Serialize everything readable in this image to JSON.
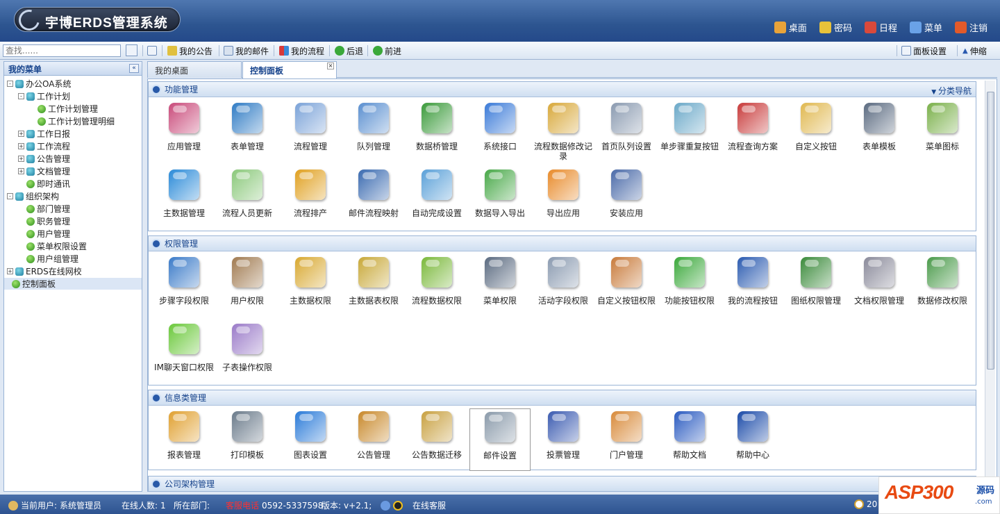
{
  "app": {
    "title": "宇博ERDS管理系统"
  },
  "topnav": [
    {
      "label": "桌面",
      "icon": "home-icon",
      "color": "#e8a33a"
    },
    {
      "label": "密码",
      "icon": "lock-icon",
      "color": "#e8c23a"
    },
    {
      "label": "日程",
      "icon": "calendar-icon",
      "color": "#d9493b"
    },
    {
      "label": "菜单",
      "icon": "menu-icon",
      "color": "#6aa2e8"
    },
    {
      "label": "注销",
      "icon": "power-icon",
      "color": "#e25a2a"
    }
  ],
  "toolbar": {
    "search_placeholder": "查找......",
    "items": [
      "我的公告",
      "我的邮件",
      "我的流程",
      "后退",
      "前进"
    ],
    "right": [
      "面板设置",
      "伸缩"
    ]
  },
  "sidebar": {
    "title": "我的菜单",
    "tree": [
      "办公OA系统",
      "工作计划",
      "工作计划管理",
      "工作计划管理明细",
      "工作日报",
      "工作流程",
      "公告管理",
      "文档管理",
      "即时通讯",
      "组织架构",
      "部门管理",
      "职务管理",
      "用户管理",
      "菜单权限设置",
      "用户组管理",
      "ERDS在线网校",
      "控制面板"
    ]
  },
  "tabs": [
    "我的桌面",
    "控制面板"
  ],
  "sections": [
    {
      "title": "功能管理",
      "nav": "分类导航",
      "items": [
        [
          "应用管理",
          "#c94a7a"
        ],
        [
          "表单管理",
          "#2f7bc4"
        ],
        [
          "流程管理",
          "#7aa2d8"
        ],
        [
          "队列管理",
          "#5a8fd0"
        ],
        [
          "数据桥管理",
          "#3a9a3a"
        ],
        [
          "系统接口",
          "#3a7ad8"
        ],
        [
          "流程数据修改记录",
          "#d8a83a"
        ],
        [
          "首页队列设置",
          "#8a9ab0"
        ],
        [
          "单步骤重复按钮",
          "#6aa8c8"
        ],
        [
          "流程查询方案",
          "#c83a3a"
        ],
        [
          "自定义按钮",
          "#e0b850"
        ],
        [
          "表单模板",
          "#5a6a80"
        ],
        [
          "菜单图标",
          "#7ab04a"
        ],
        [
          "主数据管理",
          "#2a8ad8"
        ],
        [
          "流程人员更新",
          "#8ac87a"
        ],
        [
          "流程排产",
          "#e0a020"
        ],
        [
          "邮件流程映射",
          "#3a6ab0"
        ],
        [
          "自动完成设置",
          "#5aa0d8"
        ],
        [
          "数据导入导出",
          "#48a848"
        ],
        [
          "导出应用",
          "#e88a2a"
        ],
        [
          "安装应用",
          "#4a6aa8"
        ]
      ]
    },
    {
      "title": "权限管理",
      "items": [
        [
          "步骤字段权限",
          "#3a7ac8"
        ],
        [
          "用户权限",
          "#a07a50"
        ],
        [
          "主数据权限",
          "#d8a830"
        ],
        [
          "主数据表权限",
          "#c8a838"
        ],
        [
          "流程数据权限",
          "#7ab83a"
        ],
        [
          "菜单权限",
          "#5a6a80"
        ],
        [
          "活动字段权限",
          "#8a9ab0"
        ],
        [
          "自定义按钮权限",
          "#c87a3a"
        ],
        [
          "功能按钮权限",
          "#3aa83a"
        ],
        [
          "我的流程按钮",
          "#2a5ab0"
        ],
        [
          "图纸权限管理",
          "#3a8a3a"
        ],
        [
          "文档权限管理",
          "#8a8a9a"
        ],
        [
          "数据修改权限",
          "#4a9a4a"
        ],
        [
          "IM聊天窗口权限",
          "#6ac83a"
        ],
        [
          "子表操作权限",
          "#9a7ac8"
        ]
      ]
    },
    {
      "title": "信息类管理",
      "items": [
        [
          "报表管理",
          "#e0a030"
        ],
        [
          "打印模板",
          "#6a7a8a"
        ],
        [
          "图表设置",
          "#2a7ad8"
        ],
        [
          "公告管理",
          "#c8882a"
        ],
        [
          "公告数据迁移",
          "#c8a040"
        ],
        [
          "邮件设置",
          "#8a9aaa"
        ],
        [
          "投票管理",
          "#3a5ab0"
        ],
        [
          "门户管理",
          "#d88a3a"
        ],
        [
          "帮助文档",
          "#2a5ac0"
        ],
        [
          "帮助中心",
          "#1a4aa8"
        ]
      ]
    },
    {
      "title": "公司架构管理",
      "items": []
    }
  ],
  "status": {
    "user_label": "当前用户:",
    "user": "系统管理员",
    "online_label": "在线人数:",
    "online": "1",
    "dept_label": "所在部门:",
    "hotline_label": "客服电话",
    "hotline": "0592-5337598",
    "version_label": "版本:",
    "version": "v+2.1;",
    "service": "在线客服",
    "clock": "20"
  },
  "watermark": {
    "brand": "ASP300",
    "cn": "源码",
    "domain": ".com"
  }
}
